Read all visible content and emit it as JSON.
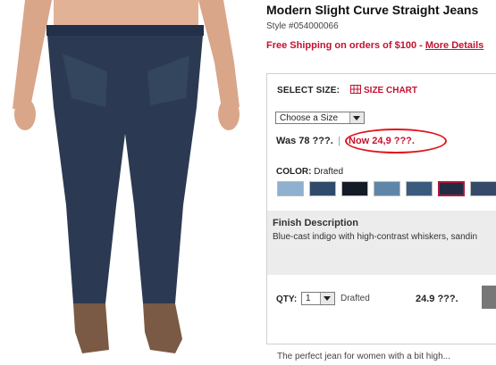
{
  "product": {
    "title": "Modern Slight Curve Straight Jeans",
    "style": "Style #054000066",
    "shipping_text": "Free Shipping on orders of $100 - ",
    "shipping_link": "More Details"
  },
  "size": {
    "label": "SELECT SIZE:",
    "chart_label": "SIZE CHART",
    "select_value": "Choose a Size"
  },
  "price": {
    "was": "Was 78 ???.",
    "separator": "|",
    "now": "Now 24,9 ???."
  },
  "color": {
    "label": "COLOR:",
    "value": "Drafted",
    "swatches": [
      "#8fb0cf",
      "#2f4a6b",
      "#141a26",
      "#5f86a8",
      "#3a5a7e",
      "#1f2d44",
      "#354a68"
    ]
  },
  "finish": {
    "title": "Finish Description",
    "text": "Blue-cast indigo with high-contrast whiskers, sandin"
  },
  "qty": {
    "label": "QTY:",
    "value": "1",
    "color_name": "Drafted",
    "price": "24.9 ???."
  },
  "bottom": {
    "text": "The perfect jean for women with a bit high..."
  }
}
